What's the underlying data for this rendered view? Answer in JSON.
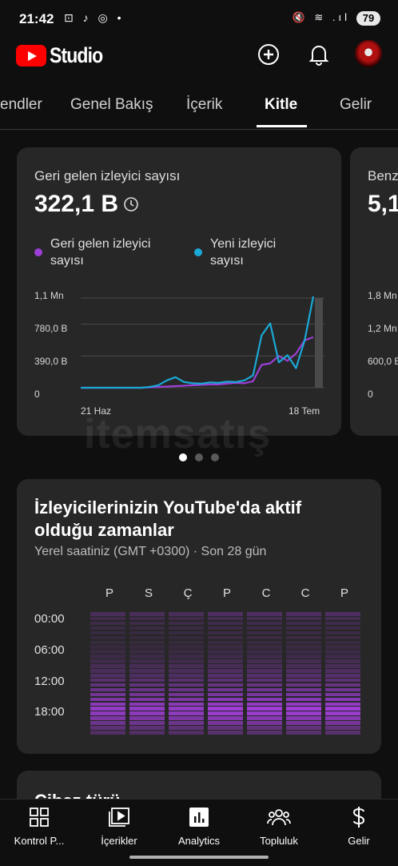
{
  "status_bar": {
    "time": "21:42",
    "left_icons": "⊡ ♪ ◎ •",
    "right_icons": "🔇 ≋ .ıl",
    "battery": "79"
  },
  "app_bar": {
    "brand": "Studio",
    "icons": [
      "create-icon",
      "bell-icon",
      "avatar"
    ]
  },
  "tabs": [
    {
      "label": "endler"
    },
    {
      "label": "Genel Bakış"
    },
    {
      "label": "İçerik"
    },
    {
      "label": "Kitle",
      "active": true
    },
    {
      "label": "Gelir"
    }
  ],
  "returning_card": {
    "title": "Geri gelen izleyici sayısı",
    "value": "322,1 B",
    "legend": [
      {
        "label": "Geri gelen izleyici sayısı",
        "color": "#9c3fd6"
      },
      {
        "label": "Yeni izleyici sayısı",
        "color": "#1aa8d6"
      }
    ],
    "y_ticks": [
      "1,1 Mn",
      "780,0 B",
      "390,0 B",
      "0"
    ],
    "x_ticks": [
      "21 Haz",
      "18 Tem"
    ]
  },
  "peek_card": {
    "title": "Benz",
    "value": "5,1",
    "y_ticks": [
      "1,8 Mn",
      "1,2 Mn",
      "600,0 B",
      "0"
    ]
  },
  "watermark": "itemsatış",
  "carousel": {
    "count": 3,
    "active": 0
  },
  "active_times": {
    "title": "İzleyicilerinizin YouTube'da aktif olduğu zamanlar",
    "subtitle": "Yerel saatiniz (GMT +0300) · Son 28 gün",
    "days": [
      "P",
      "S",
      "Ç",
      "P",
      "C",
      "C",
      "P"
    ],
    "times": [
      "00:00",
      "06:00",
      "12:00",
      "18:00"
    ],
    "accent": "#a63fe0"
  },
  "device_card": {
    "title": "Cihaz türü"
  },
  "bottom_nav": [
    {
      "label": "Kontrol P...",
      "icon": "dashboard-icon"
    },
    {
      "label": "İçerikler",
      "icon": "content-icon"
    },
    {
      "label": "Analytics",
      "icon": "analytics-icon",
      "active": true
    },
    {
      "label": "Topluluk",
      "icon": "community-icon"
    },
    {
      "label": "Gelir",
      "icon": "dollar-icon"
    }
  ],
  "chart_data": {
    "type": "line",
    "ylim": [
      0,
      1100000
    ],
    "x_start_label": "21 Haz",
    "x_end_label": "18 Tem",
    "series": [
      {
        "name": "Geri gelen izleyici sayısı",
        "color": "#9c3fd6",
        "values": [
          0,
          0,
          0,
          0,
          0,
          0,
          0,
          0,
          5000,
          10000,
          15000,
          20000,
          25000,
          30000,
          35000,
          40000,
          40000,
          50000,
          60000,
          55000,
          80000,
          280000,
          300000,
          390000,
          330000,
          420000,
          580000,
          620000
        ]
      },
      {
        "name": "Yeni izleyici sayısı",
        "color": "#1aa8d6",
        "values": [
          0,
          0,
          0,
          0,
          0,
          0,
          0,
          0,
          10000,
          30000,
          90000,
          130000,
          70000,
          55000,
          50000,
          65000,
          60000,
          75000,
          70000,
          90000,
          150000,
          640000,
          790000,
          310000,
          400000,
          240000,
          580000,
          1120000
        ]
      }
    ]
  }
}
